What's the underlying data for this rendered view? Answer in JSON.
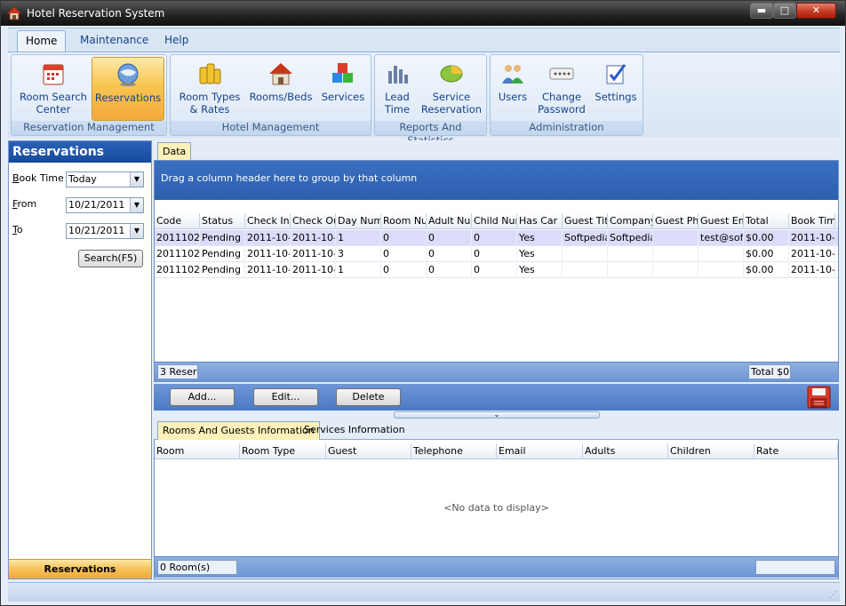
{
  "window": {
    "title": "Hotel Reservation System",
    "controls": {
      "minimize": "▬",
      "maximize": "□",
      "close": "✕"
    }
  },
  "ribbon": {
    "tabs": [
      "Home",
      "Maintenance",
      "Help"
    ],
    "groups": {
      "reservation_management": {
        "label": "Reservation Management",
        "buttons": [
          {
            "label_lines": [
              "Room Search",
              "Center"
            ],
            "icon": "calendar-icon"
          },
          {
            "label_lines": [
              "Reservations",
              ""
            ],
            "icon": "globe-icon",
            "selected": true
          }
        ]
      },
      "hotel_management": {
        "label": "Hotel Management",
        "buttons": [
          {
            "label_lines": [
              "Room Types",
              "& Rates"
            ],
            "icon": "coins-icon"
          },
          {
            "label_lines": [
              "Rooms/Beds",
              ""
            ],
            "icon": "house-icon"
          },
          {
            "label_lines": [
              "Services",
              ""
            ],
            "icon": "cubes-icon"
          }
        ]
      },
      "reports": {
        "label": "Reports And Statistics",
        "buttons": [
          {
            "label_lines": [
              "Lead",
              "Time"
            ],
            "icon": "bar-chart-icon"
          },
          {
            "label_lines": [
              "Service",
              "Reservation"
            ],
            "icon": "pie-chart-icon"
          }
        ]
      },
      "administration": {
        "label": "Administration",
        "buttons": [
          {
            "label_lines": [
              "Users",
              ""
            ],
            "icon": "users-icon"
          },
          {
            "label_lines": [
              "Change",
              "Password"
            ],
            "icon": "password-icon"
          },
          {
            "label_lines": [
              "Settings",
              ""
            ],
            "icon": "settings-icon"
          }
        ]
      }
    }
  },
  "left_panel": {
    "title": "Reservations",
    "book_time": {
      "label_key": "B",
      "label_rest": "ook Time",
      "value": "Today"
    },
    "from": {
      "label_key": "F",
      "label_rest": "rom",
      "value": "10/21/2011"
    },
    "to": {
      "label_key": "T",
      "label_rest": "o",
      "value": "10/21/2011"
    },
    "search_button": "Search(F5)",
    "footer": "Reservations"
  },
  "main": {
    "data_tab": "Data",
    "group_hint": "Drag a column header here to group by that column",
    "columns": [
      "Code",
      "Status",
      "Check In",
      "Check Ou",
      "Day Num",
      "Room Nur",
      "Adult Nun",
      "Child Num",
      "Has Car",
      "Guest Titl",
      "Company",
      "Guest Pho",
      "Guest Em",
      "Total",
      "Book Time"
    ],
    "rows": [
      [
        "20111021",
        "Pending",
        "2011-10-",
        "2011-10-2",
        "1",
        "0",
        "0",
        "0",
        "Yes",
        "Softpedia",
        "Softpedia",
        "",
        "test@soft",
        "$0.00",
        "2011-10-2"
      ],
      [
        "20111021",
        "Pending",
        "2011-10-",
        "2011-10-2",
        "3",
        "0",
        "0",
        "0",
        "Yes",
        "",
        "",
        "",
        "",
        "$0.00",
        "2011-10-2"
      ],
      [
        "20111021",
        "Pending",
        "2011-10-",
        "2011-10-2",
        "1",
        "0",
        "0",
        "0",
        "Yes",
        "",
        "",
        "",
        "",
        "$0.00",
        "2011-10-2"
      ]
    ],
    "footer_count": "3 Reserv",
    "footer_total": "Total $0.",
    "buttons": {
      "add": "Add...",
      "edit": "Edit...",
      "delete": "Delete"
    },
    "save_icon": "save-icon",
    "splitter_glyph": "⌄"
  },
  "bottom": {
    "tabs": [
      "Rooms And Guests Information",
      "Services Information"
    ],
    "columns": [
      "Room",
      "Room Type",
      "Guest",
      "Telephone",
      "Email",
      "Adults",
      "Children",
      "Rate"
    ],
    "empty_text": "<No data to display>",
    "footer_count": "0 Room(s)"
  },
  "colors": {
    "accent": "#2d5fae",
    "selected_button": "#f8c551",
    "ribbon_text": "#15428b"
  }
}
